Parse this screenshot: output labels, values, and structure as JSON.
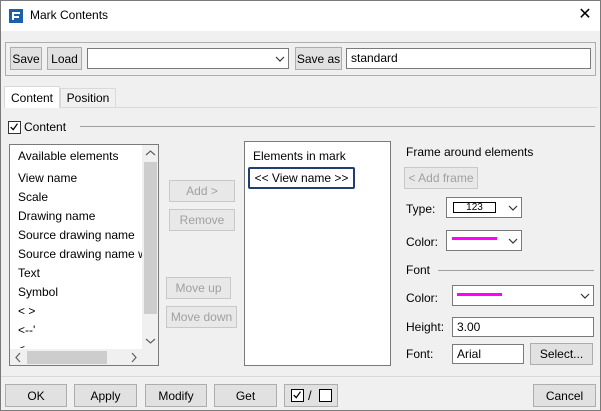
{
  "window": {
    "title": "Mark Contents",
    "close_glyph": "✕"
  },
  "toolbar": {
    "save_label": "Save",
    "load_label": "Load",
    "preset_select_value": "",
    "save_as_label": "Save as",
    "save_as_value": "standard"
  },
  "tabs": [
    {
      "label": "Content"
    },
    {
      "label": "Position"
    }
  ],
  "content_section": {
    "label": "Content",
    "checked": true
  },
  "available": {
    "header": "Available elements",
    "items": [
      "View name",
      "Scale",
      "Drawing name",
      "Source drawing name",
      "Source drawing name w",
      "Text",
      "Symbol",
      "<  >",
      "<--'",
      "<"
    ]
  },
  "middle_buttons": {
    "add_label": "Add >",
    "remove_label": "Remove",
    "move_up_label": "Move up",
    "move_down_label": "Move down"
  },
  "elements_in_mark": {
    "header": "Elements in mark",
    "items": [
      "<< View name >>"
    ]
  },
  "frame": {
    "header": "Frame around elements",
    "add_frame_label": "< Add frame",
    "type_label": "Type:",
    "type_value": "123",
    "color_label": "Color:",
    "color_value": "#ff00ff"
  },
  "font": {
    "header": "Font",
    "color_label": "Color:",
    "color_value": "#ff00ff",
    "height_label": "Height:",
    "height_value": "3.00",
    "font_label": "Font:",
    "font_value": "Arial",
    "select_label": "Select..."
  },
  "bottom": {
    "ok_label": "OK",
    "apply_label": "Apply",
    "modify_label": "Modify",
    "get_label": "Get",
    "toggle_separator": "/",
    "cancel_label": "Cancel"
  }
}
